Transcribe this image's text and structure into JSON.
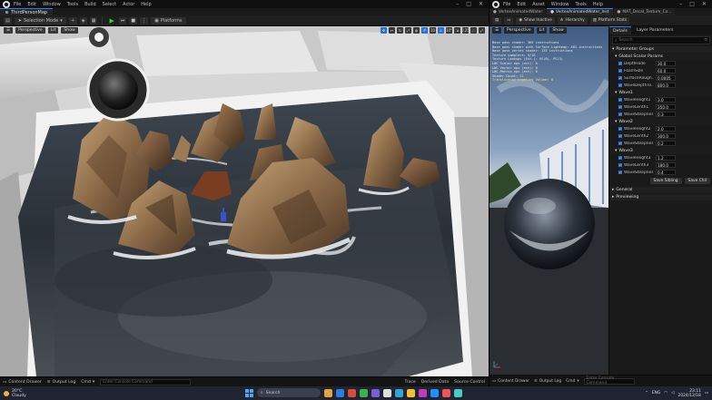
{
  "left_window": {
    "menu": [
      "File",
      "Edit",
      "Window",
      "Tools",
      "Build",
      "Select",
      "Actor",
      "Help"
    ],
    "doc_tab": "ThirdPersonMap",
    "toolbar": {
      "mode_label": "Selection Mode",
      "platforms_label": "Platforms"
    },
    "viewport": {
      "perspective_label": "Perspective",
      "lit_label": "Lit",
      "show_label": "Show",
      "grid_snap": "10",
      "angle_snap": "10°",
      "scale_snap": "0.25"
    },
    "status": {
      "content_drawer": "Content Drawer",
      "output_log": "Output Log",
      "cmd_label": "Cmd",
      "cmd_placeholder": "Enter Console Command",
      "trace": "Trace",
      "derived_data": "Derived Data",
      "source_control": "Source Control"
    }
  },
  "right_window": {
    "menu": [
      "File",
      "Edit",
      "Asset",
      "Window",
      "Tools",
      "Help"
    ],
    "tabs": [
      "VertexAnimatedWater",
      "VertexAnimatedWater_Inst",
      "MAT_Decal_Texture_Co..."
    ],
    "toolbar": {
      "save_label": "",
      "browse_label": "",
      "show_inactive": "Show Inactive",
      "hierarchy": "Hierarchy",
      "platform_stats": "Platform Stats"
    },
    "preview": {
      "perspective_label": "Perspective",
      "lit_label": "Lit",
      "show_label": "Show",
      "stats": [
        {
          "text": "Base pass shader: 369 instructions",
          "hl": false
        },
        {
          "text": "Base pass shader with Surface Lightmap: 401 instructions",
          "hl": false
        },
        {
          "text": "Base pass vertex shader: 133 instructions",
          "hl": false
        },
        {
          "text": "Texture samplers: 5/16",
          "hl": false
        },
        {
          "text": "Texture Lookups (Est.): VS(0), PS(3)",
          "hl": false
        },
        {
          "text": "LWC Scalar ops (est): 0",
          "hl": false
        },
        {
          "text": "LWC Vector ops (est): 0",
          "hl": false
        },
        {
          "text": "LWC Matrix ops (est): 0",
          "hl": false
        },
        {
          "text": "Shader Count: 11",
          "hl": false
        },
        {
          "text": "Translucency Lighting Volume: 0",
          "hl": true
        }
      ]
    },
    "details": {
      "tab_details": "Details",
      "tab_layers": "Layer Parameters",
      "search_placeholder": "Search",
      "group_parameters": "Parameter Groups",
      "groups": [
        {
          "name": "Global Scalar Params",
          "params": [
            {
              "name": "DepthFade",
              "value": "30.0",
              "on": true
            },
            {
              "name": "FoamSize",
              "value": "60.0",
              "on": true
            },
            {
              "name": "SurfaceRough...",
              "value": "0.0005",
              "on": true
            },
            {
              "name": "WaveDepthTo...",
              "value": "800.0",
              "on": true
            }
          ]
        },
        {
          "name": "Wave1",
          "params": [
            {
              "name": "WaveHeight1",
              "value": "3.0",
              "on": true
            },
            {
              "name": "WaveLenth1",
              "value": "250.0",
              "on": true
            },
            {
              "name": "WaveSteepnes",
              "value": "0.3",
              "on": true
            }
          ]
        },
        {
          "name": "Wave2",
          "params": [
            {
              "name": "WaveHeight2",
              "value": "2.0",
              "on": true
            },
            {
              "name": "WaveLenth2",
              "value": "300.0",
              "on": true
            },
            {
              "name": "WaveSteepnes",
              "value": "0.2",
              "on": true
            }
          ]
        },
        {
          "name": "Wave3",
          "params": [
            {
              "name": "WaveHeight3",
              "value": "1.2",
              "on": true
            },
            {
              "name": "WaveLenth3",
              "value": "180.0",
              "on": true
            },
            {
              "name": "WaveSteepnes",
              "value": "0.4",
              "on": true
            }
          ]
        }
      ],
      "save_sibling": "Save Sibling",
      "save_child": "Save Chil",
      "general": "General",
      "previewing": "Previewing"
    },
    "status": {
      "content_drawer": "Content Drawer",
      "output_log": "Output Log",
      "cmd_label": "Cmd",
      "cmd_placeholder": "Enter Console Command"
    }
  },
  "taskbar": {
    "weather_temp": "20°C",
    "weather_desc": "Cloudy",
    "search_placeholder": "Search",
    "lang": "ENG",
    "time": "23:11",
    "date": "2024/12/18"
  }
}
